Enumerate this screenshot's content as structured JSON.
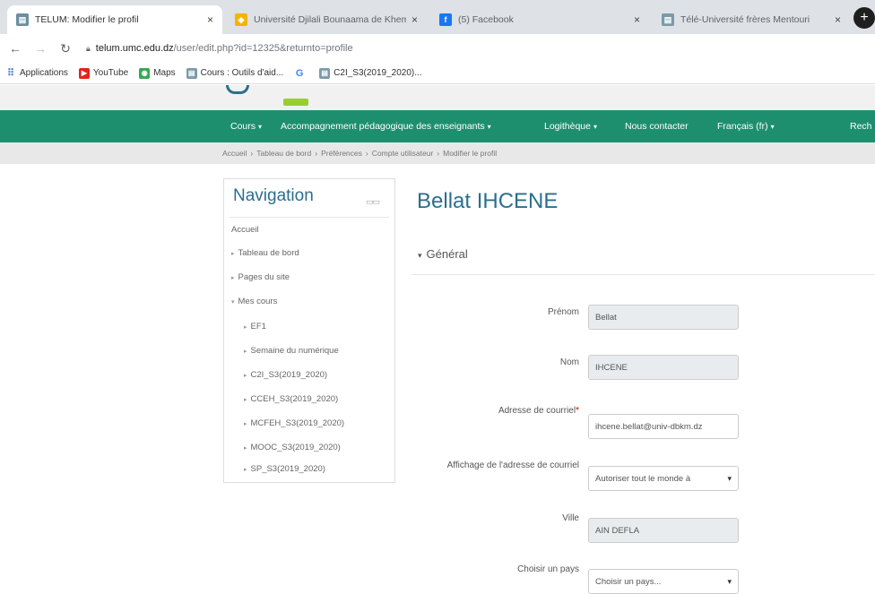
{
  "browser": {
    "tabs": [
      {
        "title": "TELUM: Modifier le profil",
        "active": true
      },
      {
        "title": "Université Djilali Bounaama de Khemis",
        "active": false
      },
      {
        "title": "(5) Facebook",
        "active": false
      },
      {
        "title": "Télé-Université frères Mentouri",
        "active": false
      }
    ],
    "url_host": "telum.umc.edu.dz",
    "url_path": "/user/edit.php?id=12325&returnto=profile",
    "bookmarks": [
      "Applications",
      "YouTube",
      "Maps",
      "Cours : Outils d'aid...",
      "C2I_S3(2019_2020)..."
    ]
  },
  "site": {
    "menu": [
      "Cours",
      "Accompagnement pédagogique des enseignants",
      "Logithèque",
      "Nous contacter",
      "Français (fr)",
      "Rech"
    ],
    "breadcrumb": [
      "Accueil",
      "Tableau de bord",
      "Préférences",
      "Compte utilisateur",
      "Modifier le profil"
    ]
  },
  "navigation": {
    "title": "Navigation",
    "items": [
      "Accueil",
      "Tableau de bord",
      "Pages du site",
      "Mes cours",
      "EF1",
      "Semaine du numérique",
      "C2I_S3(2019_2020)",
      "CCEH_S3(2019_2020)",
      "MCFEH_S3(2019_2020)",
      "MOOC_S3(2019_2020)",
      "SP_S3(2019_2020)"
    ]
  },
  "main": {
    "title": "Bellat IHCENE",
    "section": "Général",
    "fields": {
      "prenom": {
        "label": "Prénom",
        "value": "Bellat"
      },
      "nom": {
        "label": "Nom",
        "value": "IHCENE"
      },
      "email": {
        "label": "Adresse de courriel",
        "value": "ihcene.bellat@univ-dbkm.dz"
      },
      "affichage": {
        "label": "Affichage de l'adresse de courriel",
        "value": "Autoriser tout le monde à"
      },
      "ville": {
        "label": "Ville",
        "value": "AIN DEFLA"
      },
      "pays": {
        "label": "Choisir un pays",
        "value": "Choisir un pays..."
      }
    }
  }
}
